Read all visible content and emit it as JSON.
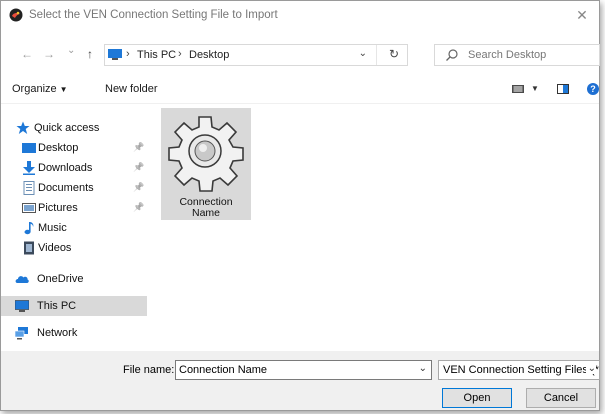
{
  "window": {
    "title": "Select the VEN Connection Setting File to Import",
    "close_glyph": "✕"
  },
  "nav_bar": {
    "back_glyph": "←",
    "forward_glyph": "→",
    "recent_glyph": "⌄",
    "up_glyph": "↑",
    "breadcrumb": [
      "This PC",
      "Desktop"
    ],
    "breadcrumb_sep": "›",
    "dropdown_glyph": "⌄",
    "refresh_glyph": "↻",
    "search_placeholder": "Search Desktop"
  },
  "toolbar": {
    "organize_label": "Organize",
    "organize_arrow": "▼",
    "new_folder_label": "New folder",
    "view_dropdown": "▼",
    "help_glyph": "?"
  },
  "navigation_pane": {
    "items": [
      {
        "label": "Quick access",
        "icon": "star-icon",
        "pinned": false
      },
      {
        "label": "Desktop",
        "icon": "desktop-icon",
        "pinned": true
      },
      {
        "label": "Downloads",
        "icon": "download-arrow-icon",
        "pinned": true
      },
      {
        "label": "Documents",
        "icon": "document-icon",
        "pinned": true
      },
      {
        "label": "Pictures",
        "icon": "pictures-icon",
        "pinned": true
      },
      {
        "label": "Music",
        "icon": "music-note-icon",
        "pinned": false
      },
      {
        "label": "Videos",
        "icon": "film-icon",
        "pinned": false
      },
      {
        "label": "OneDrive",
        "icon": "cloud-icon",
        "pinned": false
      },
      {
        "label": "This PC",
        "icon": "computer-icon",
        "pinned": false,
        "selected": true
      },
      {
        "label": "Network",
        "icon": "network-icon",
        "pinned": false
      }
    ],
    "pin_glyph": "📌"
  },
  "files": [
    {
      "name_line1": "Connection",
      "name_line2": "Name",
      "icon": "gear-icon",
      "selected": true
    }
  ],
  "bottom": {
    "file_name_label": "File name:",
    "file_name_value": "Connection Name",
    "file_name_dropdown": "⌄",
    "file_type_value": "VEN Connection Setting Files (*",
    "file_type_dropdown": "⌄",
    "open_label": "Open",
    "cancel_label": "Cancel"
  },
  "colors": {
    "selection": "#d9d9d9",
    "footer_bg": "#f0f0f0",
    "accent_blue": "#0078d7"
  }
}
